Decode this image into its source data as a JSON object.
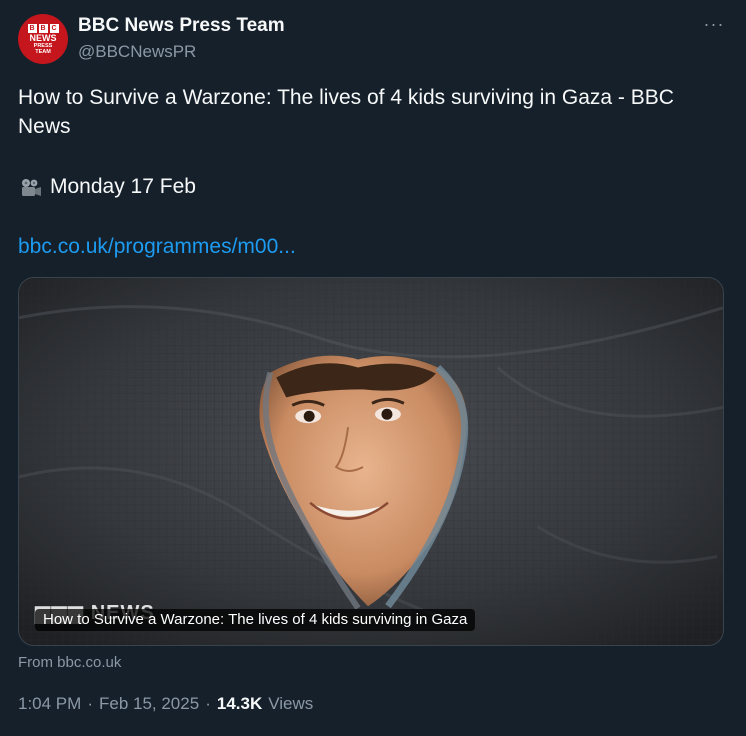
{
  "author": {
    "display_name": "BBC News Press Team",
    "handle": "@BBCNewsPR",
    "avatar_text_top": "NEWS",
    "avatar_text_bottom_1": "PRESS",
    "avatar_text_bottom_2": "TEAM",
    "avatar_color": "#c4161c"
  },
  "menu": {
    "more_label": "···"
  },
  "tweet": {
    "text": "How to Survive a Warzone: The lives of 4 kids surviving in Gaza - BBC News",
    "date_line": "Monday 17 Feb",
    "date_icon": "movie-camera-icon",
    "link_text": "bbc.co.uk/programmes/m00..."
  },
  "card": {
    "caption": "How to Survive a Warzone: The lives of 4 kids surviving in Gaza",
    "source": "From bbc.co.uk"
  },
  "meta": {
    "time": "1:04 PM",
    "date": "Feb 15, 2025",
    "separator": "·",
    "views_count": "14.3K",
    "views_label": "Views"
  },
  "colors": {
    "background": "#15202b",
    "link": "#1d9bf0",
    "secondary_text": "#8b98a5"
  }
}
